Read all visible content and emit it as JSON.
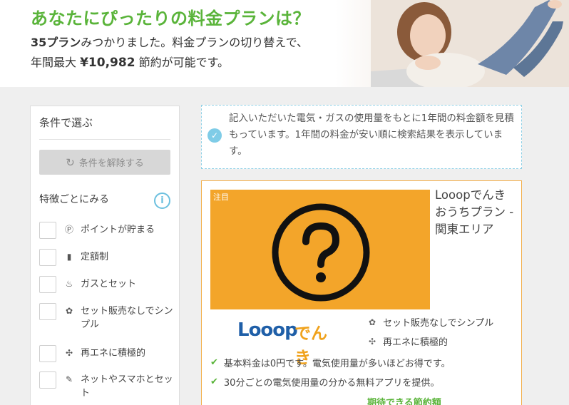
{
  "hero": {
    "title": "あなたにぴったりの料金プランは？",
    "plans_count": "35プラン",
    "line1_rest": "みつかりました。料金プランの切り替えで、",
    "line2_prefix": "年間最大 ",
    "max_saving": "¥10,982",
    "line2_suffix": " 節約が可能です。"
  },
  "sidebar": {
    "title": "条件で選ぶ",
    "reset_label": "条件を解除する",
    "section_title": "特徴ごとにみる",
    "info_icon": "i",
    "features": [
      {
        "label": "ポイントが貯まる",
        "icon": "points-icon",
        "glyph": "Ⓟ"
      },
      {
        "label": "定額制",
        "icon": "flat-rate-icon",
        "glyph": "▮"
      },
      {
        "label": "ガスとセット",
        "icon": "gas-set-icon",
        "glyph": "♨"
      },
      {
        "label": "セット販売なしでシンプル",
        "icon": "simple-icon",
        "glyph": "✿"
      },
      {
        "label": "再エネに積極的",
        "icon": "renewable-icon",
        "glyph": "✣"
      },
      {
        "label": "ネットやスマホとセット",
        "icon": "net-set-icon",
        "glyph": "✎"
      }
    ]
  },
  "notice": {
    "text": "記入いただいた電気・ガスの使用量をもとに1年間の料金額を見積もっています。1年間の料金が安い順に検索結果を表示しています。"
  },
  "card": {
    "badge": "注目",
    "title": "Looopでんき おうちプラン - 関東エリア",
    "logo_main": "Looop",
    "logo_sub": "でんき",
    "tags": [
      {
        "label": "セット販売なしでシンプル",
        "glyph": "✿"
      },
      {
        "label": "再エネに積極的",
        "glyph": "✣"
      }
    ],
    "bullets": [
      "基本料金は0円です。電気使用量が多いほどお得です。",
      "30分ごとの電気使用量の分かる無料アプリを提供。"
    ],
    "saving_label": "期待できる節約額"
  },
  "colors": {
    "accent_green": "#5ab43a",
    "card_orange": "#f3a52a",
    "info_blue": "#6cc0df"
  }
}
